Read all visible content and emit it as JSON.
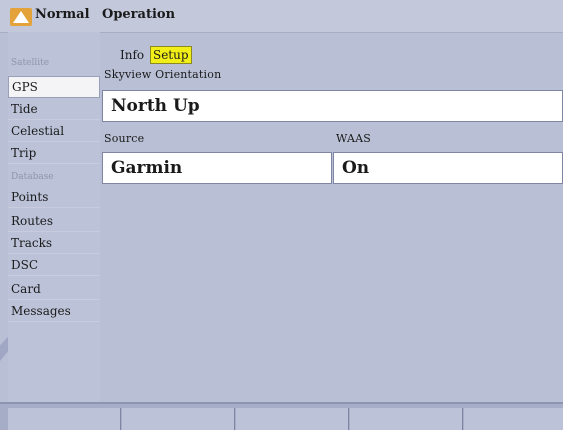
{
  "titlebar": {
    "mode_label": "Normal",
    "page_title": "Operation"
  },
  "sidebar": {
    "items": [
      {
        "label": "Satellite",
        "section": true
      },
      {
        "label": "GPS",
        "selected": true
      },
      {
        "label": "Tide"
      },
      {
        "label": "Celestial"
      },
      {
        "label": "Trip"
      },
      {
        "label": "Database",
        "section": true
      },
      {
        "label": "Points"
      },
      {
        "label": "Routes"
      },
      {
        "label": "Tracks"
      },
      {
        "label": "DSC"
      },
      {
        "label": "Card"
      },
      {
        "label": "Messages"
      }
    ]
  },
  "tabs": [
    {
      "label": "Info",
      "active": false
    },
    {
      "label": "Setup",
      "active": true
    }
  ],
  "main": {
    "skyview_orientation_label": "Skyview Orientation",
    "skyview_orientation_value": "North Up",
    "source_label": "Source",
    "source_value": "Garmin",
    "waas_label": "WAAS",
    "waas_value": "On"
  },
  "colors": {
    "background": "#b9bfd5",
    "active_tab": "#f2ef18",
    "field_bg": "#ffffff"
  }
}
